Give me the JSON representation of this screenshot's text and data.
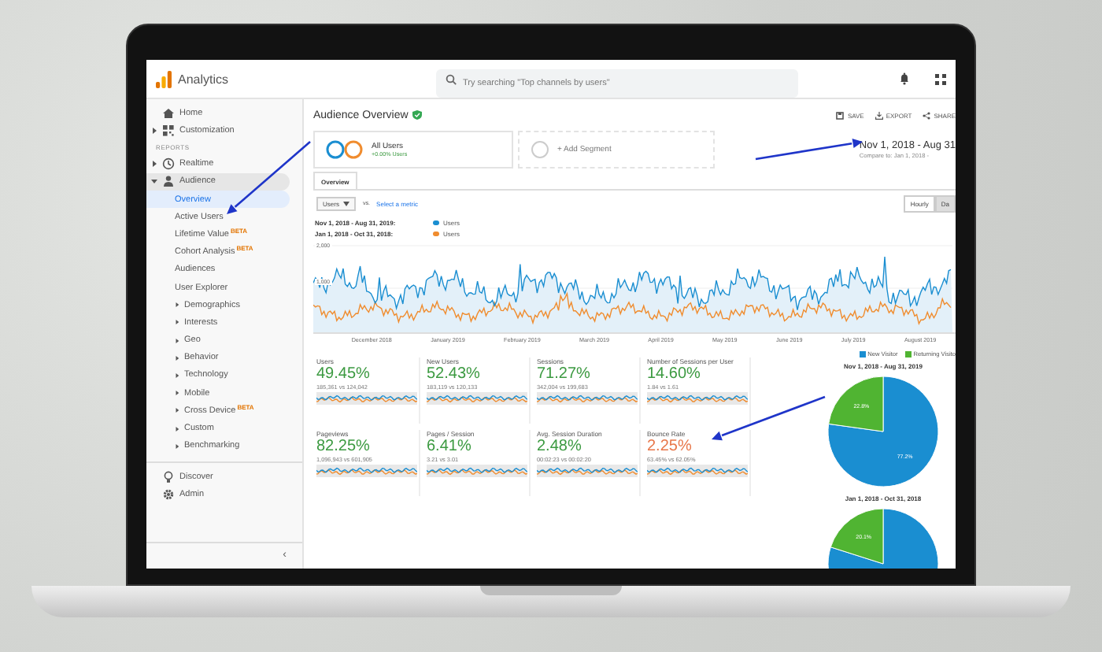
{
  "app": {
    "name": "Analytics"
  },
  "search": {
    "placeholder": "Try searching \"Top channels by users\""
  },
  "sidebar": {
    "top": [
      {
        "label": "Home"
      },
      {
        "label": "Customization",
        "expanded": false
      }
    ],
    "section_label": "REPORTS",
    "reports": [
      {
        "label": "Realtime",
        "expanded": false
      },
      {
        "label": "Audience",
        "expanded": true,
        "children": [
          {
            "label": "Overview",
            "selected": true
          },
          {
            "label": "Active Users",
            "selected": false
          },
          {
            "label": "Lifetime Value",
            "badge": "BETA",
            "selected": false
          },
          {
            "label": "Cohort Analysis",
            "badge": "BETA",
            "selected": false
          },
          {
            "label": "Audiences",
            "selected": false
          },
          {
            "label": "User Explorer",
            "selected": false
          },
          {
            "label": "Demographics",
            "expanded": false,
            "selected": false
          },
          {
            "label": "Interests",
            "expanded": false,
            "selected": false
          },
          {
            "label": "Geo",
            "expanded": false,
            "selected": false
          },
          {
            "label": "Behavior",
            "expanded": false,
            "selected": false
          },
          {
            "label": "Technology",
            "expanded": false,
            "selected": false
          },
          {
            "label": "Mobile",
            "expanded": false,
            "selected": false
          },
          {
            "label": "Cross Device",
            "badge": "BETA",
            "expanded": false,
            "selected": false
          },
          {
            "label": "Custom",
            "expanded": false,
            "selected": false
          },
          {
            "label": "Benchmarking",
            "expanded": false,
            "selected": false
          }
        ]
      }
    ],
    "bottom": [
      {
        "label": "Discover"
      },
      {
        "label": "Admin"
      }
    ],
    "collapse": "‹"
  },
  "header": {
    "title": "Audience Overview",
    "actions": [
      "SAVE",
      "EXPORT",
      "SHARE"
    ]
  },
  "segments": [
    {
      "kind": "segment",
      "name": "All Users",
      "detail": "+0.00% Users"
    },
    {
      "kind": "add",
      "name": "+ Add Segment"
    }
  ],
  "date_range": {
    "range": "Nov 1, 2018 - Aug 31",
    "compare": "Compare to: Jan 1, 2018 -"
  },
  "tabs": [
    {
      "label": "Overview",
      "selected": true
    }
  ],
  "chart_controls": {
    "metric": "Users",
    "vs": "vs.",
    "secondary": "Select a metric",
    "granularity": [
      {
        "label": "Hourly",
        "selected": false
      },
      {
        "label": "Da",
        "selected": true
      }
    ]
  },
  "legend": [
    {
      "range": "Nov 1, 2018 - Aug 31, 2019:",
      "series": "Users",
      "color": "#1a8ed1"
    },
    {
      "range": "Jan 1, 2018 - Oct 31, 2018:",
      "series": "Users",
      "color": "#f08c2e"
    }
  ],
  "line_chart": {
    "yticks": [
      "2,000",
      "1,000"
    ],
    "xlabels": [
      "December 2018",
      "January 2019",
      "February 2019",
      "March 2019",
      "April 2019",
      "May 2019",
      "June 2019",
      "July 2019",
      "August 2019"
    ]
  },
  "metrics": [
    {
      "label": "Users",
      "change": "49.45%",
      "comparison": "185,361 vs 124,042",
      "good": true
    },
    {
      "label": "New Users",
      "change": "52.43%",
      "comparison": "183,119 vs 120,133",
      "good": true
    },
    {
      "label": "Sessions",
      "change": "71.27%",
      "comparison": "342,004 vs 199,683",
      "good": true
    },
    {
      "label": "Number of Sessions per User",
      "change": "14.60%",
      "comparison": "1.84 vs 1.61",
      "good": true
    },
    {
      "label": "Pageviews",
      "change": "82.25%",
      "comparison": "1,096,943 vs 601,905",
      "good": true
    },
    {
      "label": "Pages / Session",
      "change": "6.41%",
      "comparison": "3.21 vs 3.01",
      "good": true
    },
    {
      "label": "Avg. Session Duration",
      "change": "2.48%",
      "comparison": "00:02:23 vs 00:02:20",
      "good": true
    },
    {
      "label": "Bounce Rate",
      "change": "2.25%",
      "comparison": "63.45% vs 62.05%",
      "good": false
    }
  ],
  "pies": {
    "legend": [
      {
        "label": "New Visitor",
        "color": "#1a8ed1"
      },
      {
        "label": "Returning Visito",
        "color": "#50b432"
      }
    ],
    "charts": [
      {
        "chart_data": {
          "type": "pie",
          "title": "Nov 1, 2018 - Aug 31, 2019",
          "series": [
            {
              "values": [
                77.2,
                22.8
              ]
            }
          ],
          "value_labels": [
            "77.2%",
            "22.8%"
          ]
        }
      },
      {
        "title": "Jan 1, 2018 - Oct 31, 2018",
        "label": "20.1%"
      }
    ]
  }
}
